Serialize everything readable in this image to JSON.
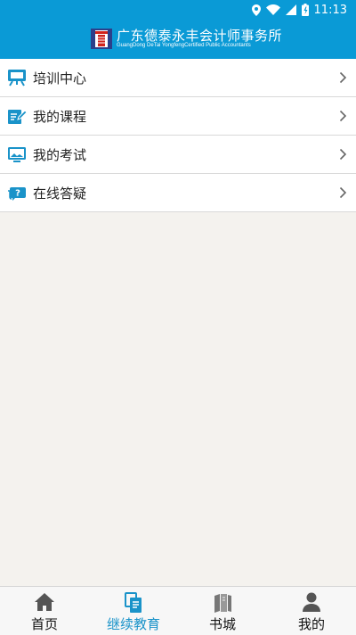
{
  "status": {
    "time": "11:13"
  },
  "header": {
    "title_cn": "广东德泰永丰会计师事务所",
    "title_en": "GuangDong DeTai YongfengCertified Public Accountants"
  },
  "menu": {
    "items": [
      {
        "label": "培训中心"
      },
      {
        "label": "我的课程"
      },
      {
        "label": "我的考试"
      },
      {
        "label": "在线答疑"
      }
    ]
  },
  "tabs": [
    {
      "label": "首页",
      "active": false
    },
    {
      "label": "继续教育",
      "active": true
    },
    {
      "label": "书城",
      "active": false
    },
    {
      "label": "我的",
      "active": false
    }
  ],
  "colors": {
    "brand": "#0a9ad6",
    "active_tab": "#1a93c9",
    "background": "#f4f2ee"
  }
}
